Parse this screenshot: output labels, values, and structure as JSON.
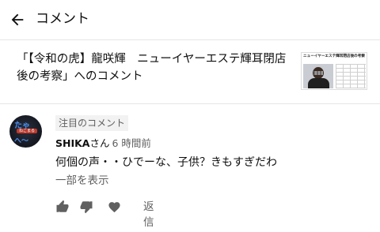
{
  "header": {
    "title": "コメント",
    "back_icon": "arrow-left-icon"
  },
  "video": {
    "title_line1": "「【令和の虎】龍咲輝　ニューイヤーエステ輝耳閉店",
    "title_line2": "後の考察」へのコメント",
    "thumbnail_caption": "ニューイヤーエステ輝耳閉店後の考察"
  },
  "comment": {
    "avatar_top": "たゃ",
    "avatar_band": "ねこまる",
    "avatar_bottom": "へ〜",
    "badge": "注目のコメント",
    "author": "SHIKA",
    "author_suffix": "さん",
    "time": "6 時間前",
    "text": "何個の声・・ひでーな、子供？きもすぎだわ",
    "read_more": "一部を表示"
  },
  "actions": {
    "like_icon": "thumbs-up-icon",
    "dislike_icon": "thumbs-down-icon",
    "heart_icon": "heart-icon",
    "reply_label": "返信"
  },
  "colors": {
    "text": "#0f0f0f",
    "secondary": "#606060",
    "divider": "#e5e5e5",
    "badge_bg": "#f2f2f2"
  }
}
